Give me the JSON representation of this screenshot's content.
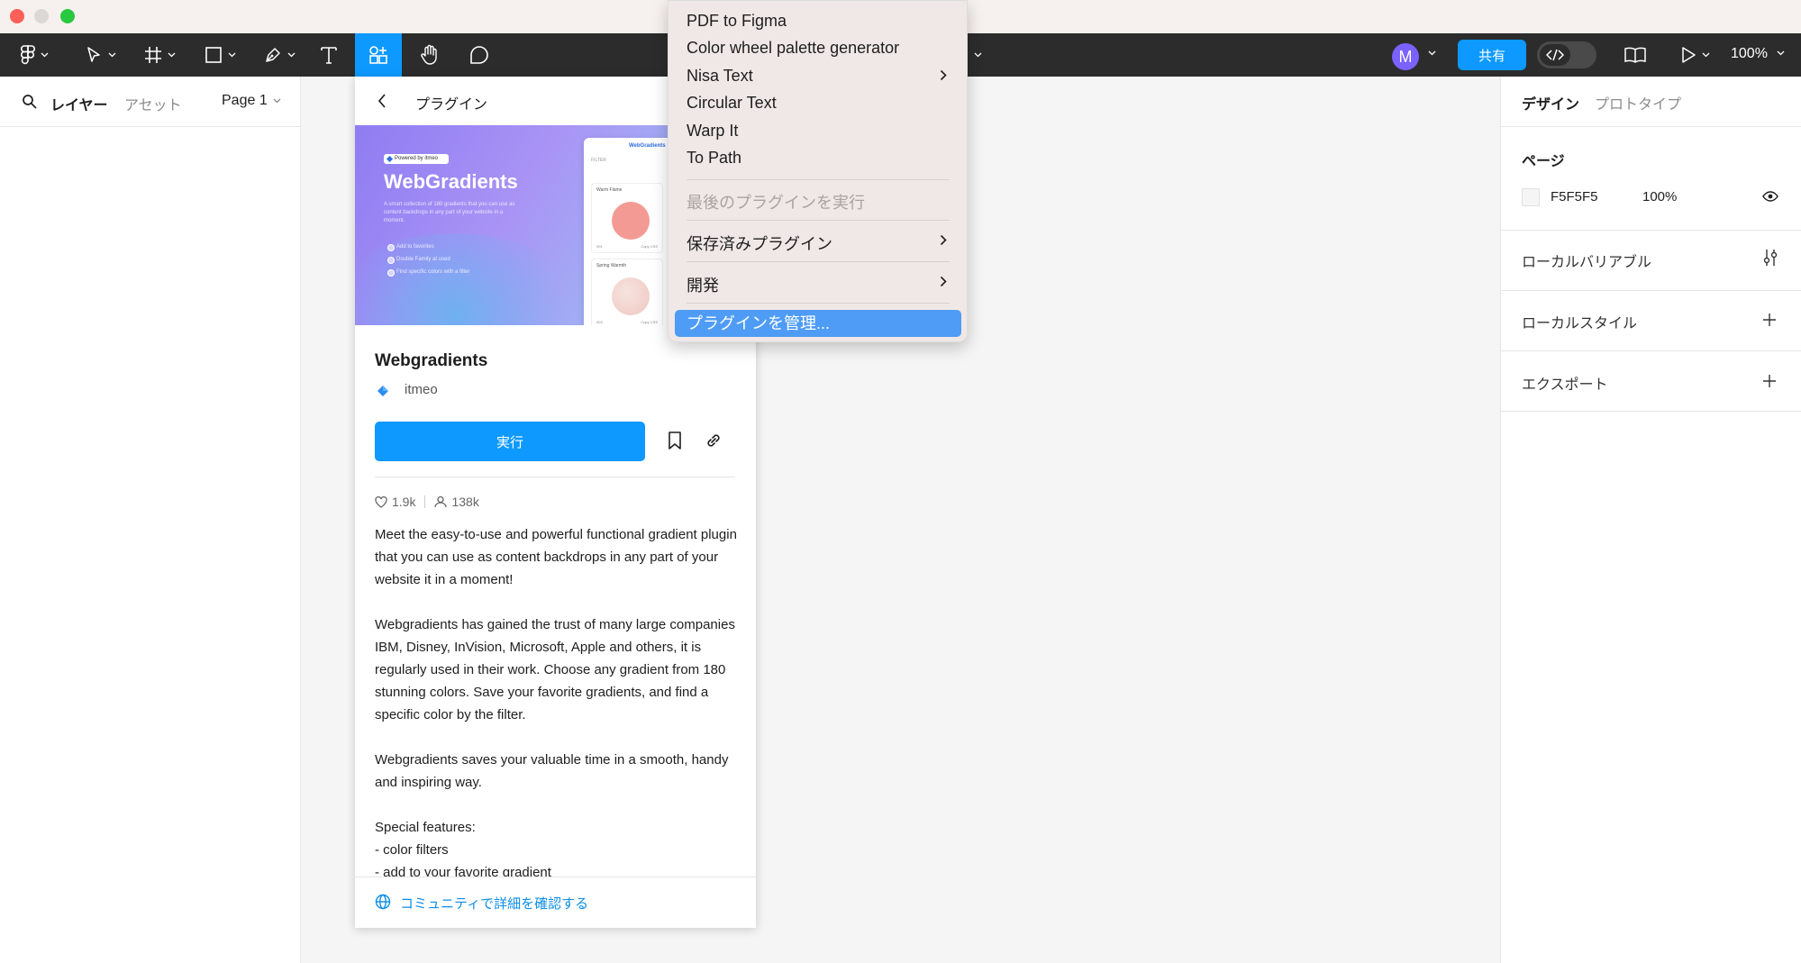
{
  "toolbar": {
    "avatar_initial": "M",
    "share_label": "共有",
    "zoom": "100%"
  },
  "left_panel": {
    "tab_layers": "レイヤー",
    "tab_assets": "アセット",
    "page_selector": "Page 1"
  },
  "plugin_panel": {
    "header_title": "プラグイン",
    "banner": {
      "badge": "Powered by itmeo",
      "title": "WebGradients",
      "description": "A smart collection of 180 gradients that you can use as content backdrops in any part of your website in a moment.",
      "features": [
        "Add to favorites",
        "Double Family at used",
        "Find specific colors with a filter"
      ],
      "mock_title": "WebGradients",
      "mock_filter": "FILTER",
      "cards": [
        {
          "name": "Warm Flame",
          "num": "001",
          "action": "Copy CSS",
          "color": "#f39a94"
        },
        {
          "name": "Spring Warmth",
          "num": "003",
          "action": "Copy CSS",
          "color": "#f4d6d0"
        }
      ]
    },
    "plugin_name": "Webgradients",
    "author": "itmeo",
    "run_label": "実行",
    "likes": "1.9k",
    "users": "138k",
    "description": [
      "Meet the easy-to-use and powerful functional gradient plugin that you can use as content backdrops in any part of your website it in a moment!",
      "Webgradients has gained the trust of many large companies IBM, Disney, InVision, Microsoft, Apple and others, it is regularly used in their work. Choose any gradient from 180 stunning colors. Save your favorite gradients, and find a specific color by the filter.",
      "Webgradients saves your valuable time in a smooth, handy and inspiring way.",
      "Special features:\n- color filters\n- add to your favorite gradient"
    ],
    "community_link": "コミュニティで詳細を確認する"
  },
  "plugins_menu": {
    "items": [
      "PDF to Figma",
      "Color wheel palette generator",
      "Nisa Text",
      "Circular Text",
      "Warp It",
      "To Path"
    ],
    "run_last": "最後のプラグインを実行",
    "saved_plugins": "保存済みプラグイン",
    "development": "開発",
    "manage_plugins": "プラグインを管理..."
  },
  "right_panel": {
    "tab_design": "デザイン",
    "tab_prototype": "プロトタイプ",
    "page_section_title": "ページ",
    "page_color_hex": "F5F5F5",
    "page_opacity": "100%",
    "local_variables": "ローカルバリアブル",
    "local_styles": "ローカルスタイル",
    "export": "エクスポート"
  },
  "colors": {
    "accent": "#0d99ff",
    "toolbar_bg": "#2c2c2c",
    "menu_highlight": "#4f9cf6"
  }
}
